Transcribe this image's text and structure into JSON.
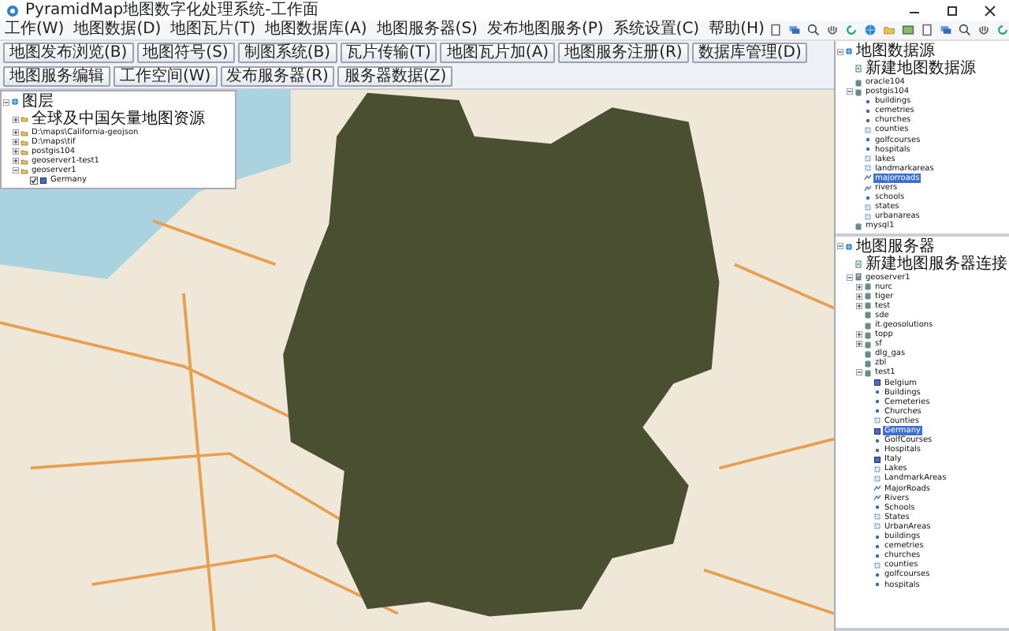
{
  "window": {
    "title": "PyramidMap地图数字化处理系统-工作面"
  },
  "menu": [
    "工作(W)",
    "地图数据(D)",
    "地图瓦片(T)",
    "地图数据库(A)",
    "地图服务器(S)",
    "发布地图服务(P)",
    "系统设置(C)",
    "帮助(H)"
  ],
  "toolbar": {
    "buttons": [
      "地图发布浏览(B)",
      "地图符号(S)",
      "制图系统(B)",
      "瓦片传输(T)",
      "地图瓦片加(A)",
      "地图服务注册(R)",
      "数据库管理(D)",
      "地图服务编辑",
      "工作空间(W)",
      "发布服务器(R)",
      "服务器数据(Z)"
    ]
  },
  "layers_panel": {
    "tree": [
      {
        "label": "图层",
        "kind": "root",
        "expanded": true,
        "children": [
          {
            "label": "全球及中国矢量地图资源",
            "kind": "source",
            "expanded": false
          },
          {
            "label": "D:\\maps\\California-geojson",
            "kind": "source",
            "expanded": false
          },
          {
            "label": "D:\\maps\\tif",
            "kind": "source",
            "expanded": false
          },
          {
            "label": "postgis104",
            "kind": "source",
            "expanded": false
          },
          {
            "label": "geoserver1-test1",
            "kind": "source",
            "expanded": false
          },
          {
            "label": "geoserver1",
            "kind": "source",
            "expanded": true,
            "children": [
              {
                "label": "Germany",
                "kind": "raster",
                "checked": true
              }
            ]
          }
        ]
      }
    ]
  },
  "datasource_panel": {
    "tree": [
      {
        "label": "地图数据源",
        "kind": "root",
        "expanded": true,
        "selected": false,
        "children": [
          {
            "label": "新建地图数据源",
            "kind": "new",
            "selected": false
          },
          {
            "label": "oracle104",
            "kind": "database",
            "selected": false
          },
          {
            "label": "postgis104",
            "kind": "database",
            "expanded": true,
            "selected": false,
            "children": [
              {
                "label": "buildings",
                "kind": "point",
                "selected": false
              },
              {
                "label": "cemetries",
                "kind": "point",
                "selected": false
              },
              {
                "label": "churches",
                "kind": "point",
                "selected": false
              },
              {
                "label": "counties",
                "kind": "polygon",
                "selected": false
              },
              {
                "label": "golfcourses",
                "kind": "point",
                "selected": false
              },
              {
                "label": "hospitals",
                "kind": "point",
                "selected": false
              },
              {
                "label": "lakes",
                "kind": "polygon",
                "selected": false
              },
              {
                "label": "landmarkareas",
                "kind": "polygon",
                "selected": false
              },
              {
                "label": "majorroads",
                "kind": "line",
                "selected": true
              },
              {
                "label": "rivers",
                "kind": "line",
                "selected": false
              },
              {
                "label": "schools",
                "kind": "point",
                "selected": false
              },
              {
                "label": "states",
                "kind": "polygon",
                "selected": false
              },
              {
                "label": "urbanareas",
                "kind": "polygon",
                "selected": false
              }
            ]
          },
          {
            "label": "mysql1",
            "kind": "database",
            "selected": false
          }
        ]
      }
    ]
  },
  "server_panel": {
    "tree": [
      {
        "label": "地图服务器",
        "kind": "root",
        "expanded": true,
        "selected": false,
        "children": [
          {
            "label": "新建地图服务器连接",
            "kind": "new",
            "selected": false
          },
          {
            "label": "geoserver1",
            "kind": "server",
            "expanded": true,
            "selected": false,
            "children": [
              {
                "label": "nurc",
                "kind": "database",
                "expanded": false,
                "selected": false
              },
              {
                "label": "tiger",
                "kind": "database",
                "expanded": false,
                "selected": false
              },
              {
                "label": "test",
                "kind": "database",
                "expanded": false,
                "selected": false
              },
              {
                "label": "sde",
                "kind": "database",
                "selected": false
              },
              {
                "label": "it.geosolutions",
                "kind": "database",
                "selected": false
              },
              {
                "label": "topp",
                "kind": "database",
                "expanded": false,
                "selected": false
              },
              {
                "label": "sf",
                "kind": "database",
                "expanded": false,
                "selected": false
              },
              {
                "label": "dlg_gas",
                "kind": "database",
                "selected": false
              },
              {
                "label": "zbl",
                "kind": "database",
                "selected": false
              },
              {
                "label": "test1",
                "kind": "database",
                "expanded": true,
                "selected": false,
                "children": [
                  {
                    "label": "Belgium",
                    "kind": "raster",
                    "selected": false
                  },
                  {
                    "label": "Buildings",
                    "kind": "point",
                    "selected": false
                  },
                  {
                    "label": "Cemeteries",
                    "kind": "point",
                    "selected": false
                  },
                  {
                    "label": "Churches",
                    "kind": "point",
                    "selected": false
                  },
                  {
                    "label": "Counties",
                    "kind": "polygon",
                    "selected": false
                  },
                  {
                    "label": "Germany",
                    "kind": "raster",
                    "selected": true
                  },
                  {
                    "label": "GolfCourses",
                    "kind": "point",
                    "selected": false
                  },
                  {
                    "label": "Hospitals",
                    "kind": "point",
                    "selected": false
                  },
                  {
                    "label": "Italy",
                    "kind": "raster",
                    "selected": false
                  },
                  {
                    "label": "Lakes",
                    "kind": "polygon",
                    "selected": false
                  },
                  {
                    "label": "LandmarkAreas",
                    "kind": "polygon",
                    "selected": false
                  },
                  {
                    "label": "MajorRoads",
                    "kind": "line",
                    "selected": false
                  },
                  {
                    "label": "Rivers",
                    "kind": "line",
                    "selected": false
                  },
                  {
                    "label": "Schools",
                    "kind": "point",
                    "selected": false
                  },
                  {
                    "label": "States",
                    "kind": "polygon",
                    "selected": false
                  },
                  {
                    "label": "UrbanAreas",
                    "kind": "polygon",
                    "selected": false
                  },
                  {
                    "label": "buildings",
                    "kind": "point",
                    "selected": false
                  },
                  {
                    "label": "cemetries",
                    "kind": "point",
                    "selected": false
                  },
                  {
                    "label": "churches",
                    "kind": "point",
                    "selected": false
                  },
                  {
                    "label": "counties",
                    "kind": "polygon",
                    "selected": false
                  },
                  {
                    "label": "golfcourses",
                    "kind": "point",
                    "selected": false
                  },
                  {
                    "label": "hospitals",
                    "kind": "point",
                    "selected": false
                  }
                ]
              }
            ]
          }
        ]
      }
    ]
  }
}
